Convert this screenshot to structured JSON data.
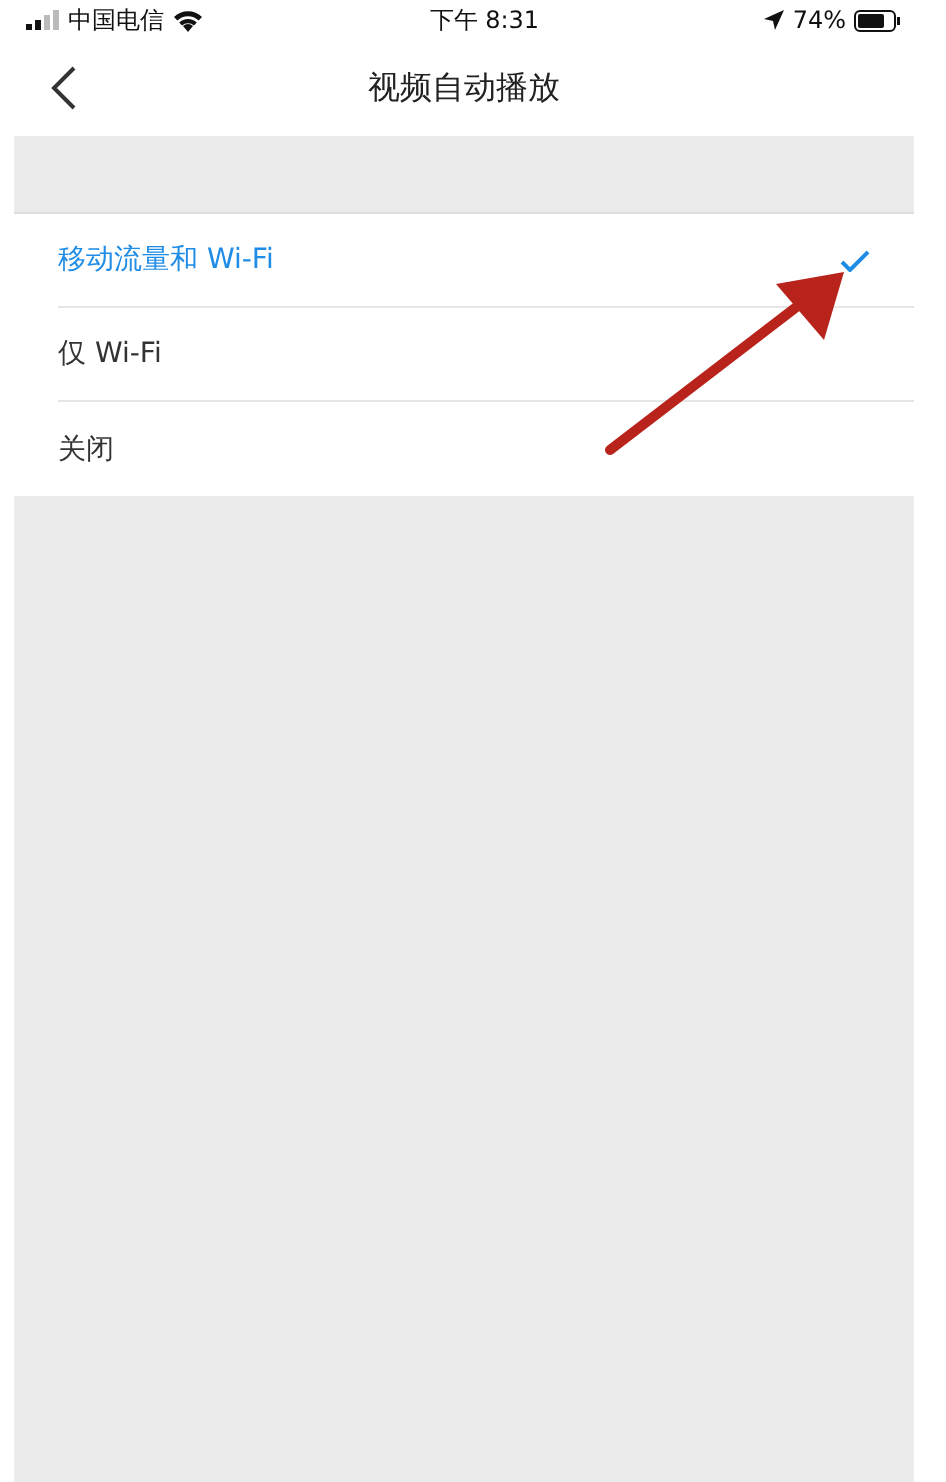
{
  "status_bar": {
    "carrier": "中国电信",
    "time": "下午 8:31",
    "battery": "74%"
  },
  "nav": {
    "title": "视频自动播放"
  },
  "options": [
    {
      "label": "移动流量和 Wi-Fi",
      "selected": true
    },
    {
      "label": "仅 Wi-Fi",
      "selected": false
    },
    {
      "label": "关闭",
      "selected": false
    }
  ]
}
